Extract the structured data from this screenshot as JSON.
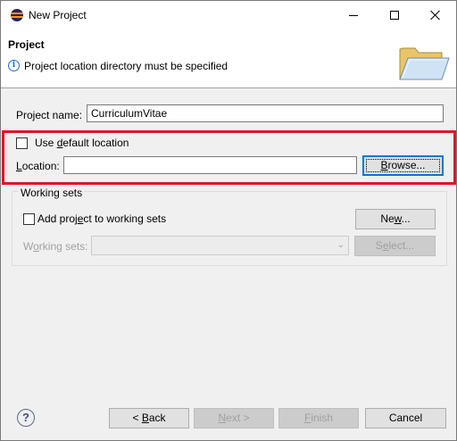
{
  "window": {
    "title": "New Project",
    "controls": [
      "minimize-icon",
      "maximize-icon",
      "close-icon"
    ]
  },
  "header": {
    "title": "Project",
    "message": "Project location directory must be specified",
    "message_icon": "info-icon",
    "banner_icon": "folder-icon"
  },
  "form": {
    "project_name_label": "Project name:",
    "project_name_value": "CurriculumVitae",
    "use_default_pre": "Use ",
    "use_default_ul": "d",
    "use_default_post": "efault location",
    "use_default_checked": false,
    "location_label_ul": "L",
    "location_label_post": "ocation:",
    "location_value": "",
    "browse_ul": "B",
    "browse_post": "rowse..."
  },
  "working_sets": {
    "group_title": "Working sets",
    "add_pre": "Add proj",
    "add_ul": "e",
    "add_post": "ct to working sets",
    "add_checked": false,
    "new_pre": "Ne",
    "new_ul": "w",
    "new_post": "...",
    "label_pre": "W",
    "label_ul": "o",
    "label_post": "rking sets:",
    "select_selected": "",
    "select_pre": "S",
    "select_ul": "e",
    "select_post": "lect..."
  },
  "footer": {
    "help_icon": "help-icon",
    "back_pre": "< ",
    "back_ul": "B",
    "back_post": "ack",
    "next_ul": "N",
    "next_post": "ext >",
    "finish_ul": "F",
    "finish_post": "inish",
    "cancel_label": "Cancel"
  },
  "colors": {
    "highlight_border": "#e0161e",
    "dialog_bg": "#f0f0f0",
    "default_button_border": "#0078d7",
    "info_blue": "#1e6fc8"
  }
}
